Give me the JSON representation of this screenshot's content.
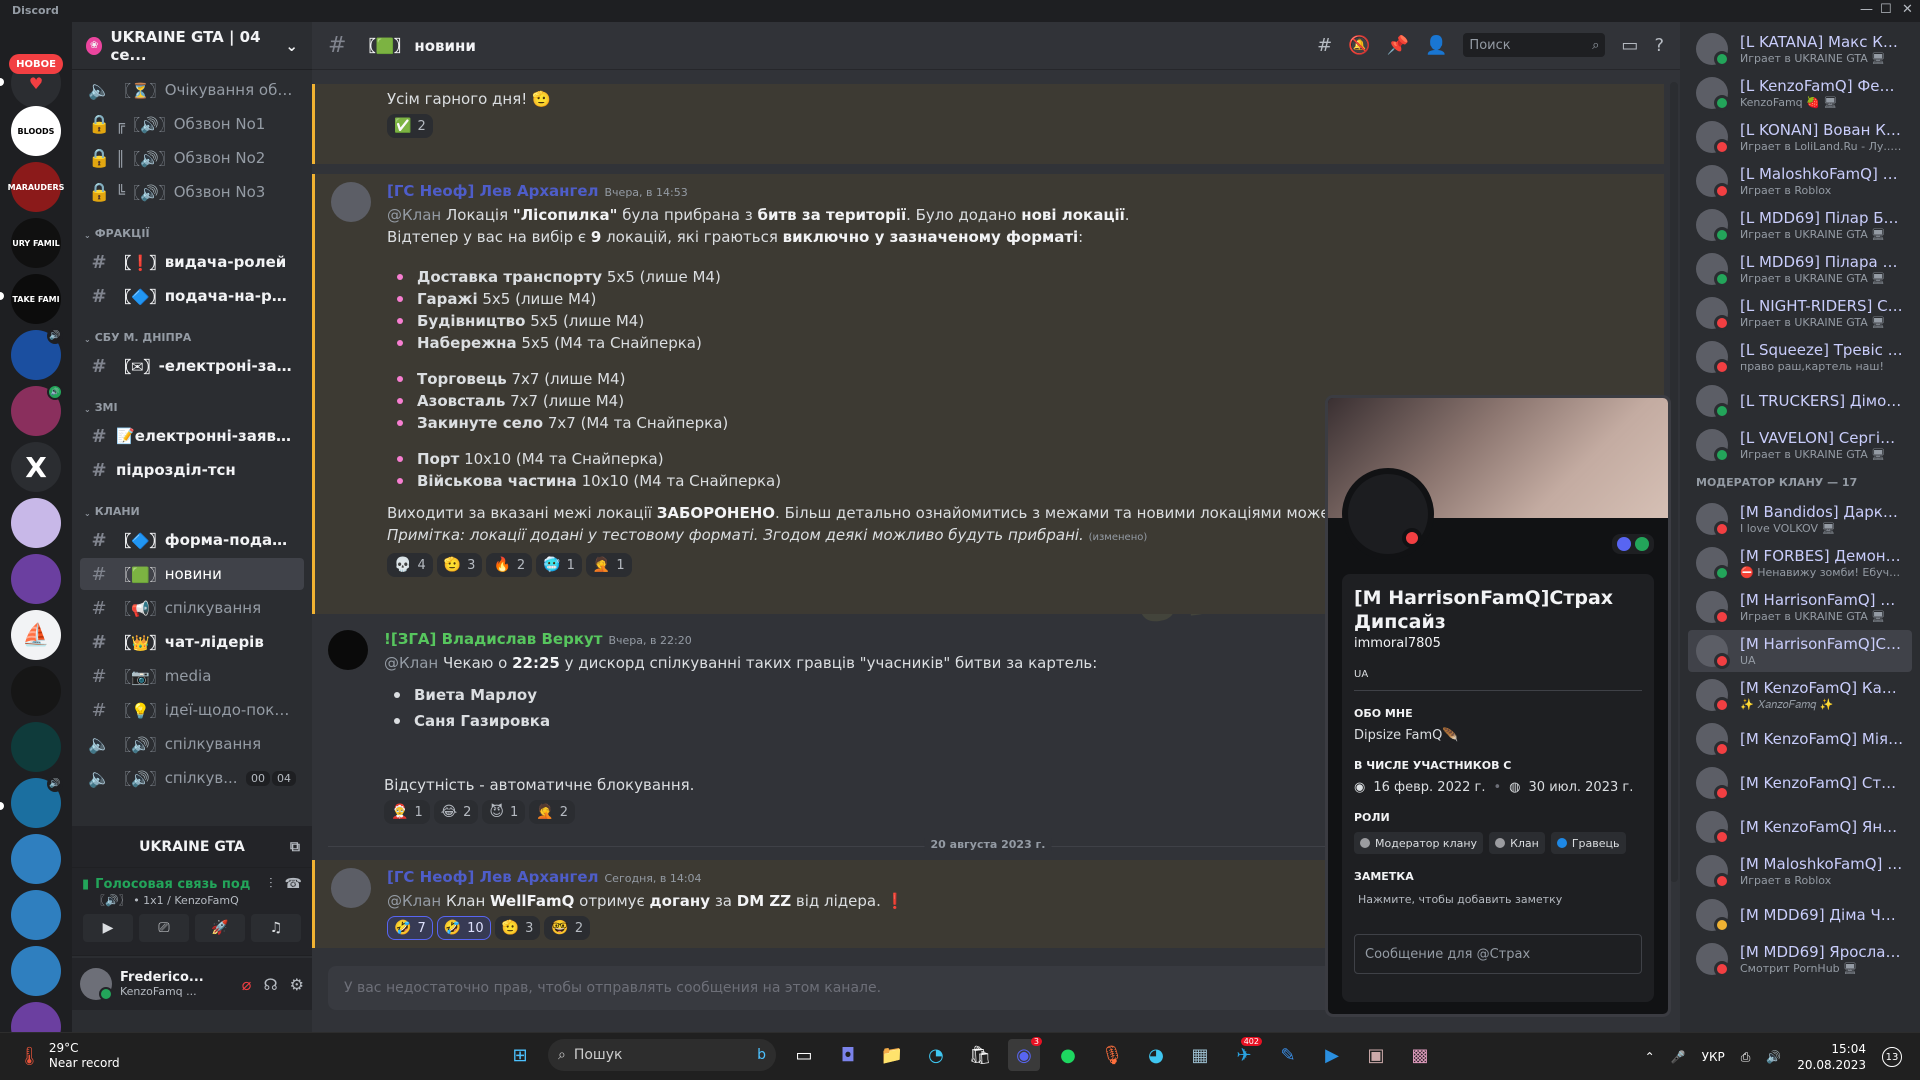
{
  "app_title": "Discord",
  "window_controls": [
    "—",
    "☐",
    "✕"
  ],
  "servers": {
    "new_badge": "НОВОЕ",
    "labels": [
      "BLOODS",
      "MARAUDERS",
      "URY FAMIL",
      "TAKE FAMI",
      "",
      "",
      "X",
      "",
      "",
      "",
      "",
      "",
      "",
      "",
      "",
      ""
    ]
  },
  "guild": {
    "name": "UKRAINE GTA | 04 се..."
  },
  "channels": [
    {
      "type": "voice",
      "prefix": "〖⏳〗",
      "name": "Очікування обзв..."
    },
    {
      "type": "lock",
      "prefix": "╔〖🔊〗",
      "name": "Обзвон No1"
    },
    {
      "type": "lock",
      "prefix": "║〖🔊〗",
      "name": "Обзвон No2"
    },
    {
      "type": "lock",
      "prefix": "╚〖🔊〗",
      "name": "Обзвон No3"
    },
    {
      "type": "category",
      "name": "ФРАКЦІЇ"
    },
    {
      "type": "text",
      "prefix": "〖❗〗",
      "name": "видача-ролей",
      "unread": true
    },
    {
      "type": "text",
      "prefix": "〖🔷〗",
      "name": "подача-на-роль",
      "unread": true
    },
    {
      "type": "category",
      "name": "СБУ М. ДНІПРА"
    },
    {
      "type": "text",
      "prefix": "〖✉〗",
      "name": "-електроні-заяв...",
      "unread": true
    },
    {
      "type": "category",
      "name": "ЗМІ"
    },
    {
      "type": "text",
      "prefix": "📝",
      "name": "електронні-заявки",
      "unread": true
    },
    {
      "type": "text",
      "prefix": "",
      "name": "підрозділ-тсн",
      "unread": true
    },
    {
      "type": "category",
      "name": "КЛАНИ"
    },
    {
      "type": "text",
      "prefix": "〖🔷〗",
      "name": "форма-подачі-н...",
      "unread": true
    },
    {
      "type": "text",
      "prefix": "〖🟩〗",
      "name": "новини",
      "active": true
    },
    {
      "type": "text",
      "prefix": "〖📢〗",
      "name": "спілкування"
    },
    {
      "type": "text",
      "prefix": "〖👑〗",
      "name": "чат-лідерів",
      "unread": true
    },
    {
      "type": "text",
      "prefix": "〖📷〗",
      "name": "media"
    },
    {
      "type": "text",
      "prefix": "〖💡〗",
      "name": "ідеї-щодо-покр..."
    },
    {
      "type": "voice",
      "prefix": "〖🔊〗",
      "name": "спілкування"
    },
    {
      "type": "voice",
      "prefix": "〖🔊〗",
      "name": "спілкув...",
      "badge1": "00",
      "badge2": "04"
    }
  ],
  "server_game": "UKRAINE GTA",
  "voice": {
    "status": "Голосовая связь под",
    "sub": "〖🔊〗 • 1х1 / KenzoFamQ"
  },
  "user": {
    "name": "Frederico...",
    "status": "KenzoFamq ..."
  },
  "header": {
    "channel": "〖🟩〗 новини",
    "search_placeholder": "Поиск"
  },
  "messages": {
    "m0": {
      "text": "Усім гарного дня! 🫡",
      "reacts": [
        {
          "e": "✅",
          "n": "2"
        }
      ]
    },
    "m1": {
      "author": "[ГС Неоф] Лев Архангел",
      "time": "Вчера, в 14:53",
      "l1": [
        "@Клан",
        " Локація ",
        "\"Лісопилка\"",
        " була прибрана з ",
        "битв за території",
        ". Було додано ",
        "нові локації",
        "."
      ],
      "l2": [
        "Відтепер у вас на вибір є ",
        "9",
        " локацій, які граються ",
        "виключно у зазначеному форматі",
        ":"
      ],
      "items": [
        {
          "b": "Доставка транспорту",
          "t": " 5х5 (лише М4)"
        },
        {
          "b": "Гаражі",
          "t": " 5х5 (лише М4)"
        },
        {
          "b": "Будівництво",
          "t": " 5х5 (лише М4)"
        },
        {
          "b": "Набережна",
          "t": " 5х5 (М4 та Снайперка)"
        },
        {
          "b": "Торговець",
          "t": " 7х7 (лише М4)"
        },
        {
          "b": "Азовсталь",
          "t": " 7х7 (лише М4)"
        },
        {
          "b": "Закинуте село",
          "t": " 7х7 (М4 та Снайперка)"
        },
        {
          "b": "Порт",
          "t": " 10х10 (М4 та Снайперка)"
        },
        {
          "b": "Військова частина",
          "t": " 10х10 (М4 та Снайперка)"
        }
      ],
      "l3": [
        "Виходити за вказані межі локації ",
        "ЗАБОРОНЕНО",
        ". Більш детально ознайомитись з межами та новими локаціями можете на форумі ",
        "\"Вій"
      ],
      "l4": "Примітка: локації додані у тестовому форматі. Згодом деякі можливо будуть прибрані.",
      "edited": "(изменено)",
      "reacts": [
        {
          "e": "💀",
          "n": "4"
        },
        {
          "e": "🫡",
          "n": "3"
        },
        {
          "e": "🔥",
          "n": "2"
        },
        {
          "e": "🥶",
          "n": "1"
        },
        {
          "e": "🤦",
          "n": "1"
        }
      ]
    },
    "m2": {
      "author": "![ЗГА] Владислав Веркут",
      "time": "Вчера, в 22:20",
      "l1": [
        "@Клан",
        " Чекаю о ",
        "22:25",
        " у дискорд спілкуванні таких гравців \"учасників\" битви за картель:"
      ],
      "items": [
        "Виета Марлоу",
        "Саня Газировка"
      ],
      "l2": "Відсутність - автоматичне блокування.",
      "reacts": [
        {
          "e": "🤶",
          "n": "1"
        },
        {
          "e": "😂",
          "n": "2"
        },
        {
          "e": "😈",
          "n": "1"
        },
        {
          "e": "🤦",
          "n": "2"
        }
      ]
    },
    "date_divider": "20 августа 2023 г.",
    "m3": {
      "author": "[ГС Неоф] Лев Архангел",
      "time": "Сегодня, в 14:04",
      "l1": [
        "@Клан",
        " Клан ",
        "WellFamQ",
        " отримує ",
        "догану",
        " за ",
        "DM ZZ",
        " від лідера. ",
        "❗"
      ],
      "reacts": [
        {
          "e": "🤣",
          "n": "7",
          "me": true
        },
        {
          "e": "🤣",
          "n": "10",
          "me": true
        },
        {
          "e": "🫡",
          "n": "3"
        },
        {
          "e": "🤓",
          "n": "2"
        }
      ]
    }
  },
  "composer_placeholder": "У вас недостаточно прав, чтобы отправлять сообщения на этом канале.",
  "members": [
    {
      "name": "[L KATANA] Макс Кат...",
      "status": "Играет в UKRAINE GTA 🖥",
      "st": "#23a55a"
    },
    {
      "name": "[L KenzoFamQ] Фени...",
      "status": "KenzoFamq 🍓 🖥",
      "st": "#23a55a"
    },
    {
      "name": "[L KONAN] Вован Ка...",
      "status": "Играет в LoliLand.Ru - Лу... 🖥",
      "st": "#f23f42"
    },
    {
      "name": "[L MaloshkoFamQ] Бо...",
      "status": "Играет в Roblox",
      "st": "#f23f42"
    },
    {
      "name": "[L MDD69] Пілар Блер",
      "status": "Играет в UKRAINE GTA 🖥",
      "st": "#23a55a"
    },
    {
      "name": "[L MDD69] Пілара Бл...",
      "status": "Играет в UKRAINE GTA 🖥",
      "st": "#23a55a"
    },
    {
      "name": "[L NIGHT-RIDERS] Се...",
      "status": "Играет в UKRAINE GTA 🖥",
      "st": "#f23f42"
    },
    {
      "name": "[L Squeeze] Тревіс Ха...",
      "status": "право раш,картель наш!",
      "st": "#f23f42"
    },
    {
      "name": "[L TRUCKERS] Дімон ...",
      "status": "",
      "st": "#23a55a"
    },
    {
      "name": "[L VAVELON] Сергій ...",
      "status": "Играет в UKRAINE GTA 🖥",
      "st": "#23a55a"
    },
    {
      "name": "[M Bandidos] Дарку...",
      "status": "I love VOLKOV 🖥",
      "st": "#f23f42"
    },
    {
      "name": "[M FORBES] Демонес...",
      "status": "⛔ Ненавижу зомби! Ебучие ...",
      "st": "#23a55a"
    },
    {
      "name": "[M HarrisonFamQ] Ро...",
      "status": "Играет в UKRAINE GTA 🖥",
      "st": "#f23f42"
    },
    {
      "name": "[M HarrisonFamQ]Ст...",
      "status": "UA",
      "st": "#f23f42",
      "sel": true
    },
    {
      "name": "[M KenzoFamQ] Ката...",
      "status": "✨ 𝑋𝑎𝑛𝑧𝑜𝐹𝑎𝑚𝑞 ✨",
      "st": "#f23f42"
    },
    {
      "name": "[M KenzoFamQ] Мія ...",
      "status": "",
      "st": "#f23f42"
    },
    {
      "name": "[M KenzoFamQ] Стел...",
      "status": "",
      "st": "#f23f42"
    },
    {
      "name": "[M KenzoFamQ] Яник...",
      "status": "",
      "st": "#f23f42"
    },
    {
      "name": "[M MaloshkoFamQ] Б...",
      "status": "Играет в Roblox",
      "st": "#f23f42"
    },
    {
      "name": "[M MDD69] Діма Чайка",
      "status": "",
      "st": "#f0b232"
    },
    {
      "name": "[M MDD69] Ярослав ...",
      "status": "Смотрит PornHub 🖥",
      "st": "#f23f42"
    }
  ],
  "members_category": "МОДЕРАТОР КЛАНУ — 17",
  "profile": {
    "name": "[M HarrisonFamQ]Страх Дипсайз",
    "tag": "immoral7805",
    "country": "UA",
    "about_label": "ОБО МНЕ",
    "about": "Dipsize FamQ🪶",
    "member_since_label": "В ЧИСЛЕ УЧАСТНИКОВ С",
    "since_discord": "16 февр. 2022 г.",
    "since_server": "30 июл. 2023 г.",
    "roles_label": "РОЛИ",
    "roles": [
      {
        "name": "Модератор клану",
        "color": "#9b9ca0"
      },
      {
        "name": "Клан",
        "color": "#9b9ca0"
      },
      {
        "name": "Гравець",
        "color": "#1e88e5"
      }
    ],
    "note_label": "ЗАМЕТКА",
    "note": "Нажмите, чтобы добавить заметку",
    "message_placeholder": "Сообщение для @Страх"
  },
  "watermark": "UKRAINE GTA",
  "taskbar": {
    "weather_temp": "29°C",
    "weather_desc": "Near record",
    "search": "Пошук",
    "lang": "УКР",
    "time": "15:04",
    "date": "20.08.2023",
    "notif": "13",
    "discord_badge": "3",
    "telegram_badge": "402"
  },
  "colors": {
    "accent": "#5865f2",
    "mention": "#f0b232",
    "author_blue": "#4e5dc9",
    "author_green": "#57c65e"
  }
}
